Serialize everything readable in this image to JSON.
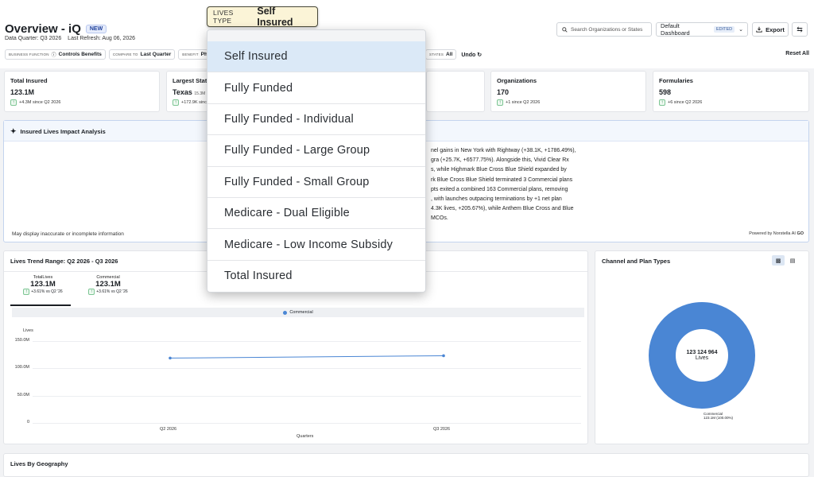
{
  "header": {
    "title": "Overview - iQ",
    "new_badge": "NEW",
    "data_quarter": "Data Quarter: Q3 2026",
    "last_refresh": "Last Refresh: Aug 06, 2026",
    "search_placeholder": "Search Organizations or States",
    "dashboard_name": "Default Dashboard",
    "edited_badge": "EDITED",
    "export_label": "Export"
  },
  "filters": {
    "business_function": {
      "key": "BUSINESS FUNCTION",
      "value": "Controls Benefits"
    },
    "compare_to": {
      "key": "COMPARE TO",
      "value": "Last Quarter"
    },
    "benefit": {
      "key": "BENEFIT",
      "value": "Pharmacy"
    },
    "states": {
      "key": "STATES",
      "value": "All"
    },
    "undo_label": "Undo",
    "reset_label": "Reset All"
  },
  "lives_type": {
    "key": "LIVES TYPE",
    "value": "Self Insured",
    "options": [
      "Self Insured",
      "Fully Funded",
      "Fully Funded - Individual",
      "Fully Funded - Large Group",
      "Fully Funded - Small Group",
      "Medicare - Dual Eligible",
      "Medicare - Low Income Subsidy",
      "Total Insured"
    ],
    "selected_index": 0
  },
  "kpis": [
    {
      "label": "Total Insured",
      "value": "123.1M",
      "delta": "+4.3M since Q2 2026"
    },
    {
      "label": "Largest State",
      "value": "Texas",
      "sub": "15.3M",
      "delta": "+172.9K since"
    },
    {
      "label": "Organizations",
      "value": "170",
      "delta": "+1 since Q2 2026"
    },
    {
      "label": "Formularies",
      "value": "598",
      "delta": "+6 since Q2 2026"
    }
  ],
  "insight": {
    "title": "Insured Lives Impact Analysis",
    "lines": [
      "nel gains in New York with Rightway (+38.1K, +1786.49%),",
      "gra (+25.7K, +6577.75%). Alongside this, Vivid Clear Rx",
      "s, while Highmark Blue Cross Blue Shield expanded by",
      "rk Blue Cross Blue Shield terminated 3 Commercial plans",
      "pts exited a combined 163 Commercial plans, removing",
      ", with launches outpacing terminations by +1 net plan",
      "4.3K lives, +205.67%), while Anthem Blue Cross and Blue",
      "MCOs."
    ],
    "disclaimer": "May display inaccurate or incomplete information",
    "powered_by": "Powered by Norstella AI"
  },
  "trend": {
    "title": "Lives Trend Range: Q2 2026 - Q3 2026",
    "tabs": [
      {
        "label": "TotalLives",
        "value": "123.1M",
        "delta": "+3.61% vs Q2 '26"
      },
      {
        "label": "Commercial",
        "value": "123.1M",
        "delta": "+3.61% vs Q2 '26"
      }
    ]
  },
  "chart_data": {
    "type": "line",
    "x": [
      "Q2 2026",
      "Q3 2026"
    ],
    "series": [
      {
        "name": "Commercial",
        "values": [
          118.8,
          123.1
        ]
      }
    ],
    "xlabel": "Quarters",
    "ylabel": "Lives",
    "yticks": [
      "0",
      "50.0M",
      "100.0M",
      "150.0M"
    ],
    "ylim": [
      0,
      150
    ],
    "grid": true,
    "legend": "top"
  },
  "channel": {
    "title": "Channel and Plan Types",
    "donut_value": "123 124 964",
    "donut_unit": "Lives",
    "slice_label": "Commercial",
    "slice_pct": "123.1M (100.00%)",
    "slice_color": "#4a86d4"
  },
  "geo": {
    "title": "Lives By Geography"
  }
}
